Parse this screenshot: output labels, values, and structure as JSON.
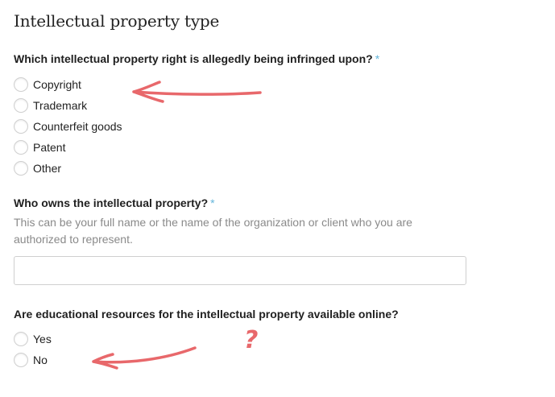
{
  "section": {
    "title": "Intellectual property type"
  },
  "q1": {
    "label": "Which intellectual property right is allegedly being infringed upon?",
    "required_marker": "*",
    "options": [
      "Copyright",
      "Trademark",
      "Counterfeit goods",
      "Patent",
      "Other"
    ],
    "selected": null
  },
  "q2": {
    "label": "Who owns the intellectual property?",
    "required_marker": "*",
    "helper": "This can be your full name or the name of the organization or client who you are authorized to represent.",
    "value": ""
  },
  "q3": {
    "label": "Are educational resources for the intellectual property available online?",
    "options": [
      "Yes",
      "No"
    ],
    "selected": null
  },
  "annotations": {
    "question_mark": "?",
    "ink_color": "#e8686b",
    "required_color": "#63b5da"
  }
}
